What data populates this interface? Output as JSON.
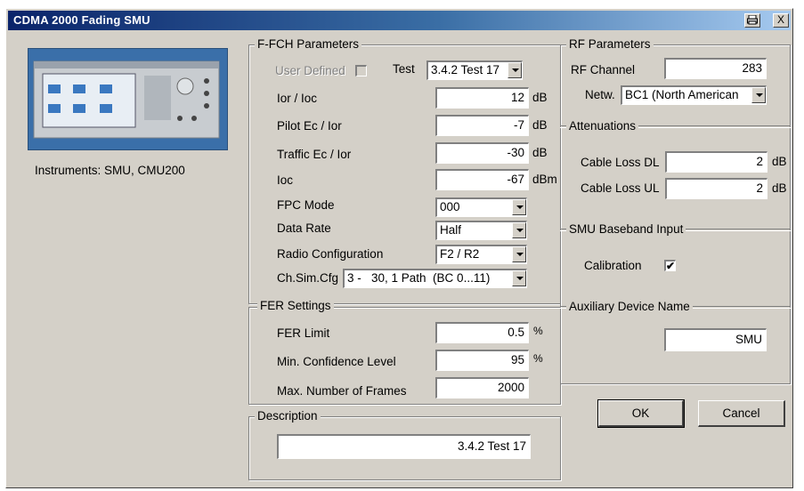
{
  "window": {
    "title": "CDMA 2000 Fading SMU",
    "print_icon": "printer-icon",
    "close_icon": "close-icon",
    "close_glyph": "X"
  },
  "instruments": {
    "label": "Instruments:  SMU, CMU200"
  },
  "ffch": {
    "group_title": "F-FCH Parameters",
    "user_defined_label": "User Defined",
    "user_defined_checked": false,
    "test_label": "Test",
    "test_value": "3.4.2 Test 17",
    "ior_ioc_label": "Ior / Ioc",
    "ior_ioc_value": "12",
    "ior_ioc_unit": "dB",
    "pilot_label": "Pilot Ec / Ior",
    "pilot_value": "-7",
    "pilot_unit": "dB",
    "traffic_label": "Traffic Ec / Ior",
    "traffic_value": "-30",
    "traffic_unit": "dB",
    "ioc_label": "Ioc",
    "ioc_value": "-67",
    "ioc_unit": "dBm",
    "fpc_label": "FPC Mode",
    "fpc_value": "000",
    "data_rate_label": "Data Rate",
    "data_rate_value": "Half",
    "radio_cfg_label": "Radio Configuration",
    "radio_cfg_value": "F2 / R2",
    "chsim_label": "Ch.Sim.Cfg",
    "chsim_value": "3 -   30, 1 Path  (BC 0...11)"
  },
  "fer": {
    "group_title": "FER Settings",
    "limit_label": "FER Limit",
    "limit_value": "0.5",
    "limit_unit": "%",
    "confidence_label": "Min. Confidence Level",
    "confidence_value": "95",
    "confidence_unit": "%",
    "frames_label": "Max. Number of Frames",
    "frames_value": "2000"
  },
  "description": {
    "group_title": "Description",
    "value": "3.4.2 Test 17"
  },
  "rf": {
    "group_title": "RF Parameters",
    "channel_label": "RF Channel",
    "channel_value": "283",
    "network_label": "Netw.",
    "network_value": "BC1 (North American"
  },
  "attenuations": {
    "group_title": "Attenuations",
    "dl_label": "Cable Loss DL",
    "dl_value": "2",
    "dl_unit": "dB",
    "ul_label": "Cable Loss UL",
    "ul_value": "2",
    "ul_unit": "dB"
  },
  "baseband": {
    "group_title": "SMU Baseband Input",
    "calibration_label": "Calibration",
    "calibration_checked": true,
    "check_glyph": "✔"
  },
  "aux": {
    "group_title": "Auxiliary Device Name",
    "value": "SMU"
  },
  "buttons": {
    "ok_label": "OK",
    "cancel_label": "Cancel"
  }
}
